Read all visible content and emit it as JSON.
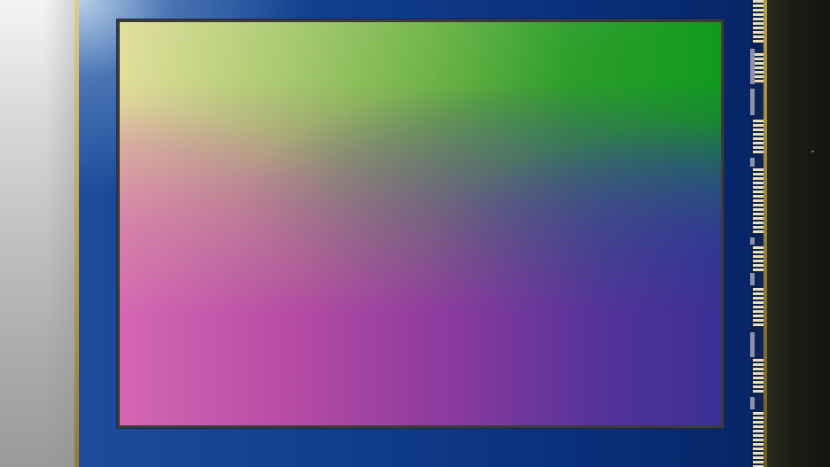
{
  "scene": {
    "subject": "image-sensor",
    "colors": {
      "package_blue": "#0f3a88",
      "sensor_top_left": "#dedb90",
      "sensor_top_right": "#119a1e",
      "sensor_bottom_left": "#d567b3",
      "sensor_bottom_right": "#3b2f95",
      "gold_edge": "#b7a35a",
      "backdrop_left": "#d9d9d9",
      "backdrop_right": "#1c1c14"
    }
  }
}
